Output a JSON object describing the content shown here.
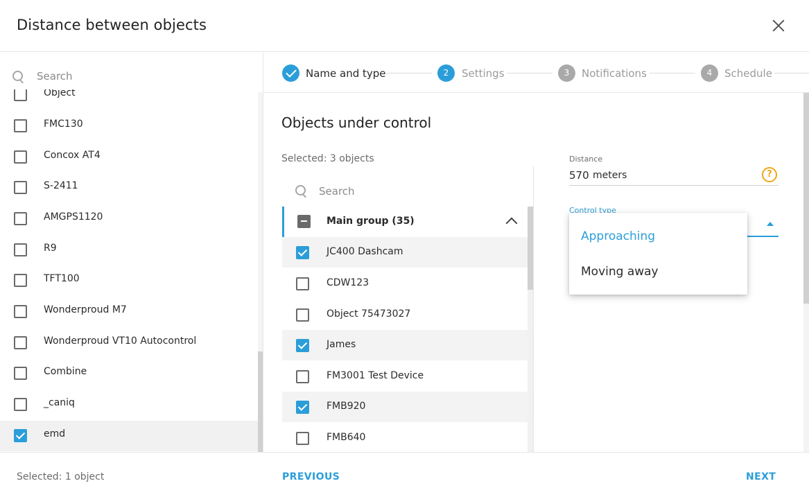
{
  "dialog": {
    "title": "Distance between objects",
    "close_icon": "close-icon"
  },
  "left_panel": {
    "search_placeholder": "Search",
    "items": [
      {
        "label": "Object",
        "checked": false
      },
      {
        "label": "FMC130",
        "checked": false
      },
      {
        "label": "Concox AT4",
        "checked": false
      },
      {
        "label": "S-2411",
        "checked": false
      },
      {
        "label": "AMGPS1120",
        "checked": false
      },
      {
        "label": "R9",
        "checked": false
      },
      {
        "label": "TFT100",
        "checked": false
      },
      {
        "label": "Wonderproud M7",
        "checked": false
      },
      {
        "label": "Wonderproud VT10 Autocontrol",
        "checked": false
      },
      {
        "label": "Combine",
        "checked": false
      },
      {
        "label": "_caniq",
        "checked": false
      },
      {
        "label": "emd",
        "checked": true
      }
    ]
  },
  "stepper": {
    "steps": [
      {
        "number": "",
        "label": "Name and type",
        "state": "done"
      },
      {
        "number": "2",
        "label": "Settings",
        "state": "active"
      },
      {
        "number": "3",
        "label": "Notifications",
        "state": "idle"
      },
      {
        "number": "4",
        "label": "Schedule",
        "state": "idle"
      }
    ]
  },
  "objects_panel": {
    "title": "Objects under control",
    "selected_text": "Selected: 3 objects",
    "search_placeholder": "Search",
    "group": {
      "label": "Main group (35)",
      "state": "partial",
      "expanded": true
    },
    "items": [
      {
        "label": "JC400 Dashcam",
        "checked": true
      },
      {
        "label": "CDW123",
        "checked": false
      },
      {
        "label": "Object 75473027",
        "checked": false
      },
      {
        "label": "James",
        "checked": true
      },
      {
        "label": "FM3001 Test Device",
        "checked": false
      },
      {
        "label": "FMB920",
        "checked": true
      },
      {
        "label": "FMB640",
        "checked": false
      }
    ]
  },
  "settings": {
    "distance_label": "Distance",
    "distance_value": "570",
    "distance_unit": "meters",
    "control_type_label": "Control type",
    "control_type_options": [
      "Approaching",
      "Moving away"
    ],
    "highlighted_option": "Approaching"
  },
  "footer": {
    "selected_text": "Selected: 1 object",
    "previous_label": "PREVIOUS",
    "next_label": "NEXT"
  },
  "colors": {
    "accent": "#2b9ed9",
    "help": "#f0a818",
    "idle_step": "#a9a9a9"
  }
}
